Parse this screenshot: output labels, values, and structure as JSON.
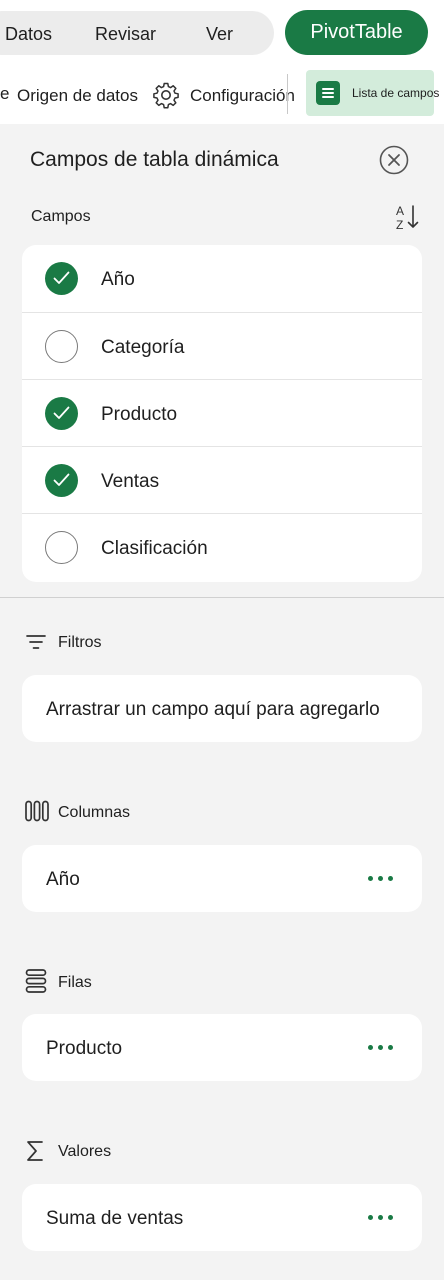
{
  "ribbon_tabs": [
    "Datos",
    "Revisar",
    "Ver"
  ],
  "pivot_tab": "PivotTable",
  "ribbon": {
    "cut_fragment": "e",
    "data_source": "Origen de datos",
    "settings": "Configuración",
    "field_list": "Lista de campos"
  },
  "panel": {
    "title": "Campos de tabla dinámica",
    "fields_label": "Campos",
    "sort_icon": "sort-az-icon",
    "close_icon": "close-circle-icon"
  },
  "fields": [
    {
      "label": "Año",
      "checked": true
    },
    {
      "label": "Categoría",
      "checked": false
    },
    {
      "label": "Producto",
      "checked": true
    },
    {
      "label": "Ventas",
      "checked": true
    },
    {
      "label": "Clasificación",
      "checked": false
    }
  ],
  "areas": {
    "filters": {
      "label": "Filtros",
      "value": "Arrastrar un campo aquí para agregarlo",
      "icon": "filter-icon"
    },
    "columns": {
      "label": "Columnas",
      "value": "Año",
      "icon": "columns-icon"
    },
    "rows": {
      "label": "Filas",
      "value": "Producto",
      "icon": "rows-icon"
    },
    "values": {
      "label": "Valores",
      "value": "Suma de ventas",
      "icon": "sigma-icon"
    }
  },
  "colors": {
    "accent": "#1a7a45",
    "accent_light": "#d3ecdb",
    "panel_bg": "#f3f3f3"
  }
}
